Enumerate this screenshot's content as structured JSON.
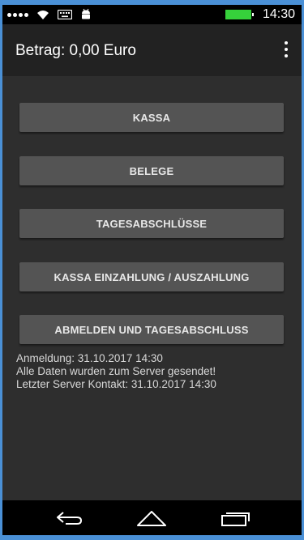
{
  "status_bar": {
    "time": "14:30",
    "battery_color": "#36d13b",
    "icons": [
      "signal-icon",
      "wifi-icon",
      "keyboard-icon",
      "android-icon",
      "battery-icon"
    ]
  },
  "app_bar": {
    "title": "Betrag: 0,00 Euro",
    "menu_icon": "overflow-menu-icon"
  },
  "menu": {
    "buttons": [
      {
        "label": "KASSA"
      },
      {
        "label": "BELEGE"
      },
      {
        "label": "TAGESABSCHLÜSSE"
      },
      {
        "label": "KASSA EINZAHLUNG / AUSZAHLUNG"
      },
      {
        "label": "ABMELDEN UND TAGESABSCHLUSS"
      }
    ]
  },
  "info": {
    "login": "Anmeldung: 31.10.2017 14:30",
    "sync_status": "Alle Daten wurden zum Server gesendet!",
    "last_contact": "Letzter Server Kontakt: 31.10.2017 14:30"
  },
  "nav_bar": {
    "icons": [
      "back-icon",
      "home-icon",
      "recent-apps-icon"
    ]
  },
  "colors": {
    "background": "#2e2e2e",
    "app_bar": "#222222",
    "button": "#545454",
    "frame": "#4a90d6"
  }
}
